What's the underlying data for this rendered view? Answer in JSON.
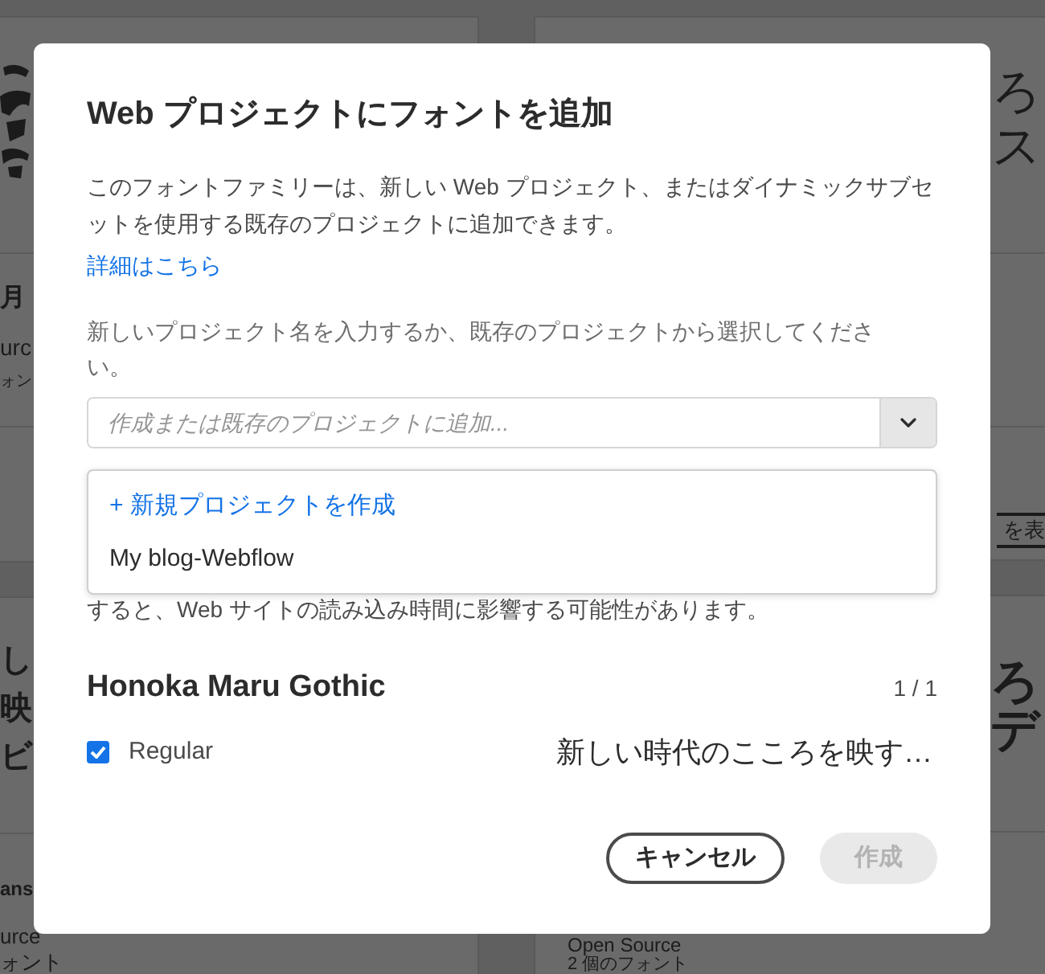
{
  "background": {
    "left_column": {
      "card_1": {
        "title": "月",
        "source": "urc",
        "fonts": "ォン"
      },
      "card_2": {
        "sample_lines": [
          "し",
          "映",
          "ビ"
        ],
        "title": "ans",
        "source": "urce",
        "fonts": "ォント"
      }
    },
    "right_column": {
      "card_1": {
        "sample_lines": [
          "ろ",
          "ス"
        ],
        "button": "を表"
      },
      "card_2": {
        "sample_lines": [
          "ろ",
          "デ"
        ],
        "source": "Open Source",
        "fonts": "2 個のフォント"
      }
    }
  },
  "dialog": {
    "title": "Web プロジェクトにフォントを追加",
    "description": "このフォントファミリーは、新しい Web プロジェクト、またはダイナミックサブセットを使用する既存のプロジェクトに追加できます。",
    "learn_more_link": "詳細はこちら",
    "instruction": "新しいプロジェクト名を入力するか、既存のプロジェクトから選択してください。",
    "project_select": {
      "placeholder": "作成または既存のプロジェクトに追加...",
      "expanded": true,
      "options": [
        {
          "kind": "create",
          "label": "+ 新規プロジェクトを作成",
          "selected": false
        },
        {
          "kind": "project",
          "label": "My blog-Webflow",
          "selected": false
        }
      ]
    },
    "notice": "すると、Web サイトの読み込み時間に影響する可能性があります。",
    "font_family": {
      "name": "Honoka Maru Gothic",
      "count": "1 / 1",
      "styles": [
        {
          "name": "Regular",
          "checked": true,
          "sample": "新しい時代のこころを映す…"
        }
      ]
    },
    "buttons": [
      {
        "label": "キャンセル",
        "kind": "secondary",
        "disabled": false
      },
      {
        "label": "作成",
        "kind": "primary",
        "disabled": true
      }
    ]
  }
}
